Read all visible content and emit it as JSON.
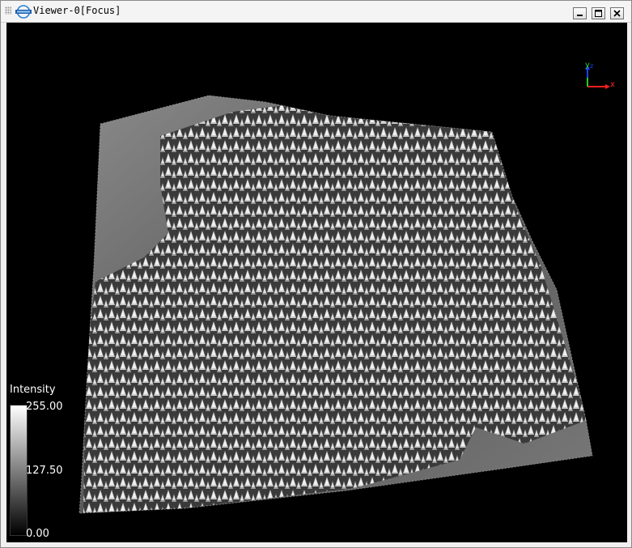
{
  "window": {
    "title": "Viewer-0[Focus]",
    "logo_icon": "lidar360-logo-icon",
    "controls": [
      "minimize-icon",
      "maximize-icon",
      "close-icon"
    ]
  },
  "legend": {
    "title": "Intensity",
    "max": "255.00",
    "mid": "127.50",
    "min": "0.00",
    "gradient": [
      "#ffffff",
      "#000000"
    ]
  },
  "axes": {
    "x": "x",
    "y": "y",
    "z": "z"
  },
  "colors": {
    "x_axis": "#ff2020",
    "y_axis": "#20d020",
    "z_axis": "#2040ff",
    "background": "#000000"
  }
}
